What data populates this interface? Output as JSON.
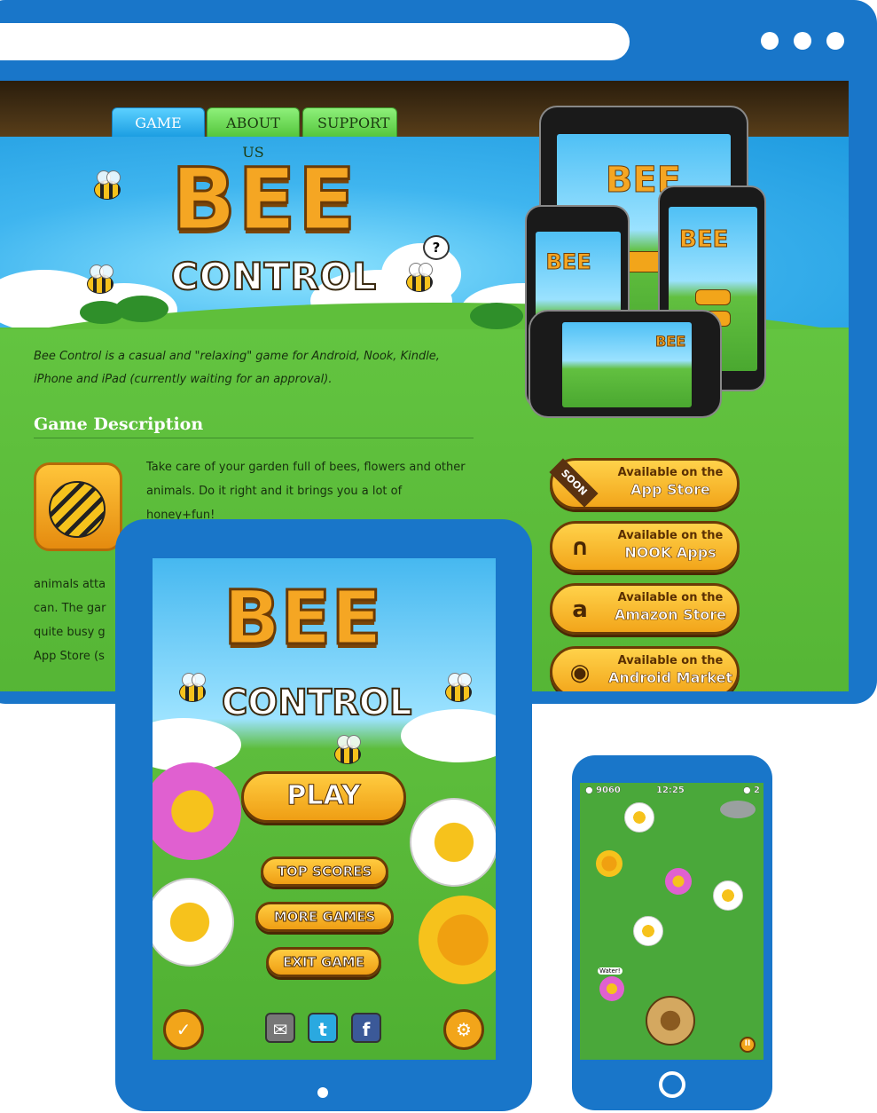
{
  "nav": {
    "tabs": [
      {
        "label": "GAME",
        "active": true
      },
      {
        "label": "ABOUT US",
        "active": false
      },
      {
        "label": "SUPPORT",
        "active": false
      }
    ]
  },
  "logo": {
    "line1": "BEE",
    "line2": "CONTROL"
  },
  "hero": {
    "question_mark": "?"
  },
  "intro": "Bee Control is a casual and \"relaxing\" game for Android, Nook, Kindle, iPhone and iPad (currently waiting for an approval).",
  "section": {
    "title": "Game Description"
  },
  "description": {
    "p1": "Take care of your garden full of bees, flowers and other animals. Do it right and it brings you a lot of honey+fun!",
    "p2_lines": [
      "animals atta",
      "can. The gar",
      "quite busy g",
      "App Store (s"
    ]
  },
  "stores": [
    {
      "line1": "Available on the",
      "line2": "App Store",
      "icon": "phone-icon",
      "ribbon": "SOON"
    },
    {
      "line1": "Available on the",
      "line2": "NOOK Apps",
      "icon": "nook-icon",
      "ribbon": ""
    },
    {
      "line1": "Available on the",
      "line2": "Amazon Store",
      "icon": "amazon-icon",
      "ribbon": ""
    },
    {
      "line1": "Available on the",
      "line2": "Android Market",
      "icon": "android-icon",
      "ribbon": ""
    }
  ],
  "tablet": {
    "logo_line1": "BEE",
    "logo_line2": "CONTROL",
    "buttons": {
      "play": "PLAY",
      "top_scores": "TOP SCORES",
      "more_games": "MORE GAMES",
      "exit_game": "EXIT GAME"
    }
  },
  "phone": {
    "score": "9060",
    "time": "12:25",
    "lives": "2",
    "speech": "Water!"
  },
  "colors": {
    "frame": "#1976c9",
    "honey": "#f5a623",
    "grass": "#5cbf3c",
    "sky": "#3fb5ef"
  }
}
